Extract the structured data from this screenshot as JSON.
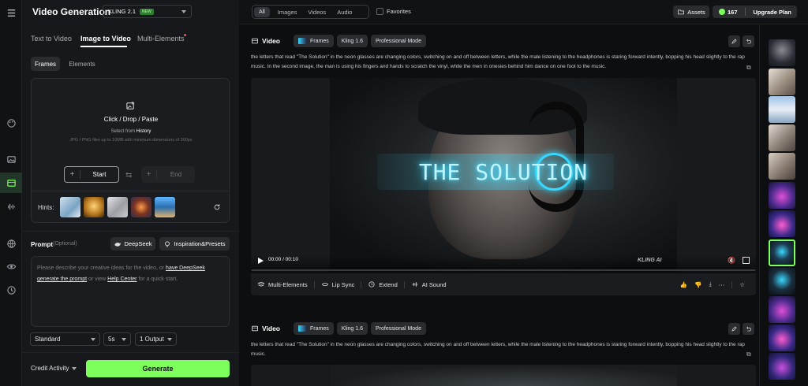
{
  "app": {
    "title": "Video Generation",
    "model": "KLING 2.1",
    "model_badge": "NEW"
  },
  "tabs": [
    {
      "label": "Text to Video"
    },
    {
      "label": "Image to Video",
      "active": true
    },
    {
      "label": "Multi-Elements",
      "dot": true
    }
  ],
  "subtabs": [
    {
      "label": "Frames",
      "active": true
    },
    {
      "label": "Elements"
    }
  ],
  "upload": {
    "title": "Click / Drop / Paste",
    "select_prefix": "Select from",
    "select_link": "History",
    "note": "JPG / PNG files up to 10MB with minimum dimensions of 300px",
    "start": "Start",
    "end": "End"
  },
  "hints_label": "Hints:",
  "prompt": {
    "label": "Prompt",
    "optional": "(Optional)",
    "deepseek_btn": "DeepSeek",
    "inspiration_btn": "Inspiration&Presets",
    "placeholder_1": "Please describe your creative ideas for the video, or",
    "placeholder_link_1": "have DeepSeek generate the prompt",
    "placeholder_2": "or view",
    "placeholder_link_2": "Help Center",
    "placeholder_3": "for a quick start."
  },
  "settings": {
    "mode": "Standard",
    "duration": "5s",
    "outputs": "1 Output"
  },
  "footer": {
    "credit": "Credit Activity",
    "generate": "Generate"
  },
  "filter": {
    "tabs": [
      "All",
      "Images",
      "Videos",
      "Audio"
    ],
    "active": "All",
    "favorites": "Favorites"
  },
  "account": {
    "assets": "Assets",
    "credits": "167",
    "upgrade": "Upgrade Plan"
  },
  "cards": [
    {
      "type": "Video",
      "tags": [
        "Frames",
        "Kling 1.6",
        "Professional Mode"
      ],
      "description": "the letters that read \"The Solution\" in the neon glasses are changing colors, switching on and off between letters, while the male listening to the headphones is staring forward intently, bopping his head slightly to the rap music. In the second image, the man is using his fingers and hands to scratch the vinyl, while the men in onesies behind him dance on one foot to the music.",
      "overlay_text": "THE SOLUTION",
      "time": "00:00 / 00:10",
      "watermark": "KLING AI",
      "actions": [
        "Multi-Elements",
        "Lip Sync",
        "Extend",
        "AI Sound"
      ]
    },
    {
      "type": "Video",
      "tags": [
        "Frames",
        "Kling 1.6",
        "Professional Mode"
      ],
      "description": "the letters that read \"The Solution\" in the neon glasses are changing colors, switching on and off between letters, while the male listening to the headphones is staring forward intently, bopping his head slightly to the rap music."
    }
  ],
  "colors": {
    "accent": "#7dff5c",
    "badge": "#2e7d32",
    "neon": "#39d8ff"
  }
}
